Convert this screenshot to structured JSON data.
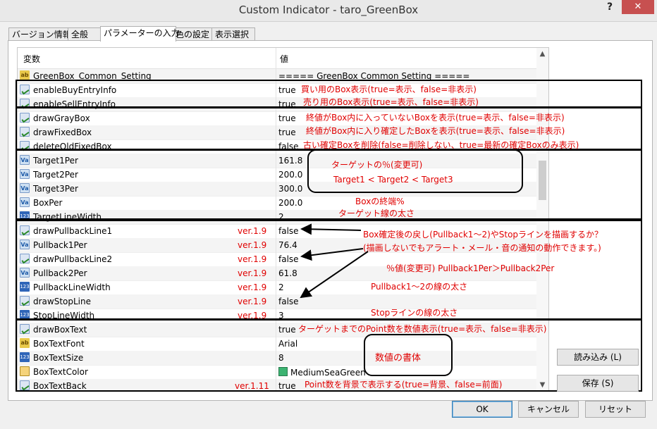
{
  "window": {
    "title": "Custom Indicator - taro_GreenBox",
    "help": "?",
    "close": "✕"
  },
  "tabs": [
    "バージョン情報",
    "全般",
    "パラメーターの入力",
    "色の設定",
    "表示選択"
  ],
  "grid": {
    "col_name": "変数",
    "col_value": "値",
    "rows": [
      {
        "icon": "ab",
        "name": "GreenBox_Common_Setting",
        "ver": "",
        "value": "===== GreenBox Common Setting ====="
      },
      {
        "icon": "check",
        "name": "enableBuyEntryInfo",
        "ver": "",
        "value": "true"
      },
      {
        "icon": "check",
        "name": "enableSellEntryInfo",
        "ver": "",
        "value": "true"
      },
      {
        "icon": "check",
        "name": "drawGrayBox",
        "ver": "",
        "value": "true"
      },
      {
        "icon": "check",
        "name": "drawFixedBox",
        "ver": "",
        "value": "true"
      },
      {
        "icon": "check",
        "name": "deleteOldFixedBox",
        "ver": "",
        "value": "false"
      },
      {
        "icon": "va",
        "name": "Target1Per",
        "ver": "",
        "value": "161.8"
      },
      {
        "icon": "va",
        "name": "Target2Per",
        "ver": "",
        "value": "200.0"
      },
      {
        "icon": "va",
        "name": "Target3Per",
        "ver": "",
        "value": "300.0"
      },
      {
        "icon": "va",
        "name": "BoxPer",
        "ver": "",
        "value": "200.0"
      },
      {
        "icon": "123",
        "name": "TargetLineWidth",
        "ver": "",
        "value": "2"
      },
      {
        "icon": "check",
        "name": "drawPullbackLine1",
        "ver": "ver.1.9",
        "value": "false"
      },
      {
        "icon": "va",
        "name": "Pullback1Per",
        "ver": "ver.1.9",
        "value": "76.4"
      },
      {
        "icon": "check",
        "name": "drawPullbackLine2",
        "ver": "ver.1.9",
        "value": "false"
      },
      {
        "icon": "va",
        "name": "Pullback2Per",
        "ver": "ver.1.9",
        "value": "61.8"
      },
      {
        "icon": "123",
        "name": "PullbackLineWidth",
        "ver": "ver.1.9",
        "value": "2"
      },
      {
        "icon": "check",
        "name": "drawStopLine",
        "ver": "ver.1.9",
        "value": "false"
      },
      {
        "icon": "123",
        "name": "StopLineWidth",
        "ver": "ver.1.9",
        "value": "3"
      },
      {
        "icon": "check",
        "name": "drawBoxText",
        "ver": "",
        "value": "true"
      },
      {
        "icon": "ab",
        "name": "BoxTextFont",
        "ver": "",
        "value": "Arial"
      },
      {
        "icon": "123",
        "name": "BoxTextSize",
        "ver": "",
        "value": "8"
      },
      {
        "icon": "color",
        "name": "BoxTextColor",
        "ver": "",
        "value": "MediumSeaGreen"
      },
      {
        "icon": "check",
        "name": "BoxTextBack",
        "ver": "ver.1.11",
        "value": "true"
      }
    ]
  },
  "annotations": {
    "buy": "買い用のBox表示(true=表示、false=非表示)",
    "sell": "売り用のBox表示(true=表示、false=非表示)",
    "gray": "終値がBox内に入っていないBoxを表示(true=表示、false=非表示)",
    "fixed": "終値がBox内に入り確定したBoxを表示(true=表示、false=非表示)",
    "delete": "古い確定Boxを削除(false=削除しない、true=最新の確定Boxのみ表示)",
    "target_change": "ターゲットの％(変更可)",
    "target_order": "Target1 < Target2 < Target3",
    "boxper": "Boxの終端%",
    "target_width": "ターゲット線の太さ",
    "pullback_draw": "Box確定後の戻し(Pullback1～2)やStopラインを描画するか？",
    "pullback_alert": "(描画しないでもアラート・メール・音の通知の動作できます。)",
    "pullback_per": "％値(変更可) Pullback1Per＞Pullback2Per",
    "pullback_width": "Pullback1～2の線の太さ",
    "stop_width": "Stopラインの線の太さ",
    "boxtext": "ターゲットまでのPoint数を数値表示(true=表示、false=非表示)",
    "font": "数値の書体",
    "boxback": "Point数を背景で表示する(true=背景、false=前面)"
  },
  "buttons": {
    "load": "読み込み (L)",
    "save": "保存 (S)",
    "ok": "OK",
    "cancel": "キャンセル",
    "reset": "リセット"
  },
  "colors": {
    "annotation": "#e00000",
    "swatch": "#3cb371"
  }
}
